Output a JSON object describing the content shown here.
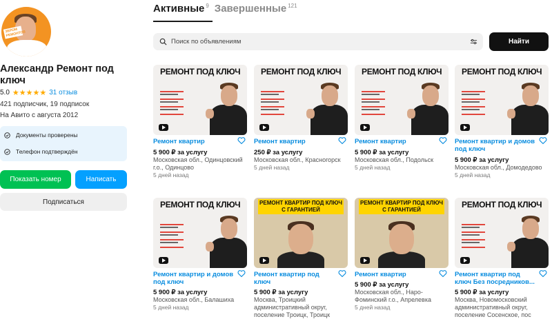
{
  "seller": {
    "avatar_badge": "ЗЕРОМ РЕМОНТОВ",
    "name": "Александр Ремонт под ключ",
    "rating": "5.0",
    "stars": "★★★★★",
    "reviews": "31 отзыв",
    "followers": "421 подписчик, 19 подписок",
    "since": "На Авито с августа 2012",
    "verifications": [
      "Документы проверены",
      "Телефон подтверждён"
    ],
    "show_number_label": "Показать номер",
    "write_label": "Написать",
    "subscribe_label": "Подписаться"
  },
  "tabs": [
    {
      "label": "Активные",
      "count": "9"
    },
    {
      "label": "Завершенные",
      "count": "121"
    }
  ],
  "search": {
    "placeholder": "Поиск по объявлениям",
    "button_label": "Найти"
  },
  "colors": {
    "accent_blue": "#0a8ddf",
    "green": "#00c153",
    "button_blue": "#04a0ff",
    "star": "#ffab00"
  },
  "thumbnail_text": {
    "title": "РЕМОНТ ПОД КЛЮЧ",
    "guarantee_banner": "РЕМОНТ КВАРТИР ПОД КЛЮЧ С ГАРАНТИЕЙ"
  },
  "listings": [
    {
      "title": "Ремонт квартир",
      "price": "5 900 ₽ за услугу",
      "location": "Московская обл., Одинцовский г.о., Одинцово",
      "date": "5 дней назад",
      "thumb": "classic"
    },
    {
      "title": "Ремонт квартир",
      "price": "250 ₽ за услугу",
      "location": "Московская обл., Красногорск",
      "date": "5 дней назад",
      "thumb": "classic"
    },
    {
      "title": "Ремонт квартир",
      "price": "5 900 ₽ за услугу",
      "location": "Московская обл., Подольск",
      "date": "5 дней назад",
      "thumb": "classic"
    },
    {
      "title": "Ремонт квартир и домов под ключ",
      "price": "5 900 ₽ за услугу",
      "location": "Московская обл., Домодедово",
      "date": "5 дней назад",
      "thumb": "classic"
    },
    {
      "title": "Ремонт квартир и домов под ключ",
      "price": "5 900 ₽ за услугу",
      "location": "Московская обл., Балашиха",
      "date": "5 дней назад",
      "thumb": "classic"
    },
    {
      "title": "Ремонт квартир под ключ",
      "price": "5 900 ₽ за услугу",
      "location": "Москва, Троицкий административный округ, поселение Троицк, Троицк",
      "date": "",
      "thumb": "guarantee"
    },
    {
      "title": "Ремонт квартир",
      "price": "5 900 ₽ за услугу",
      "location": "Московская обл., Наро-Фоминский г.о., Апрелевка",
      "date": "5 дней назад",
      "thumb": "guarantee"
    },
    {
      "title": "Ремонт квартир под ключ Без посредников...",
      "price": "5 900 ₽ за услугу",
      "location": "Москва, Новомосковский административный округ, поселение Сосенское, пос",
      "date": "",
      "thumb": "classic"
    }
  ]
}
